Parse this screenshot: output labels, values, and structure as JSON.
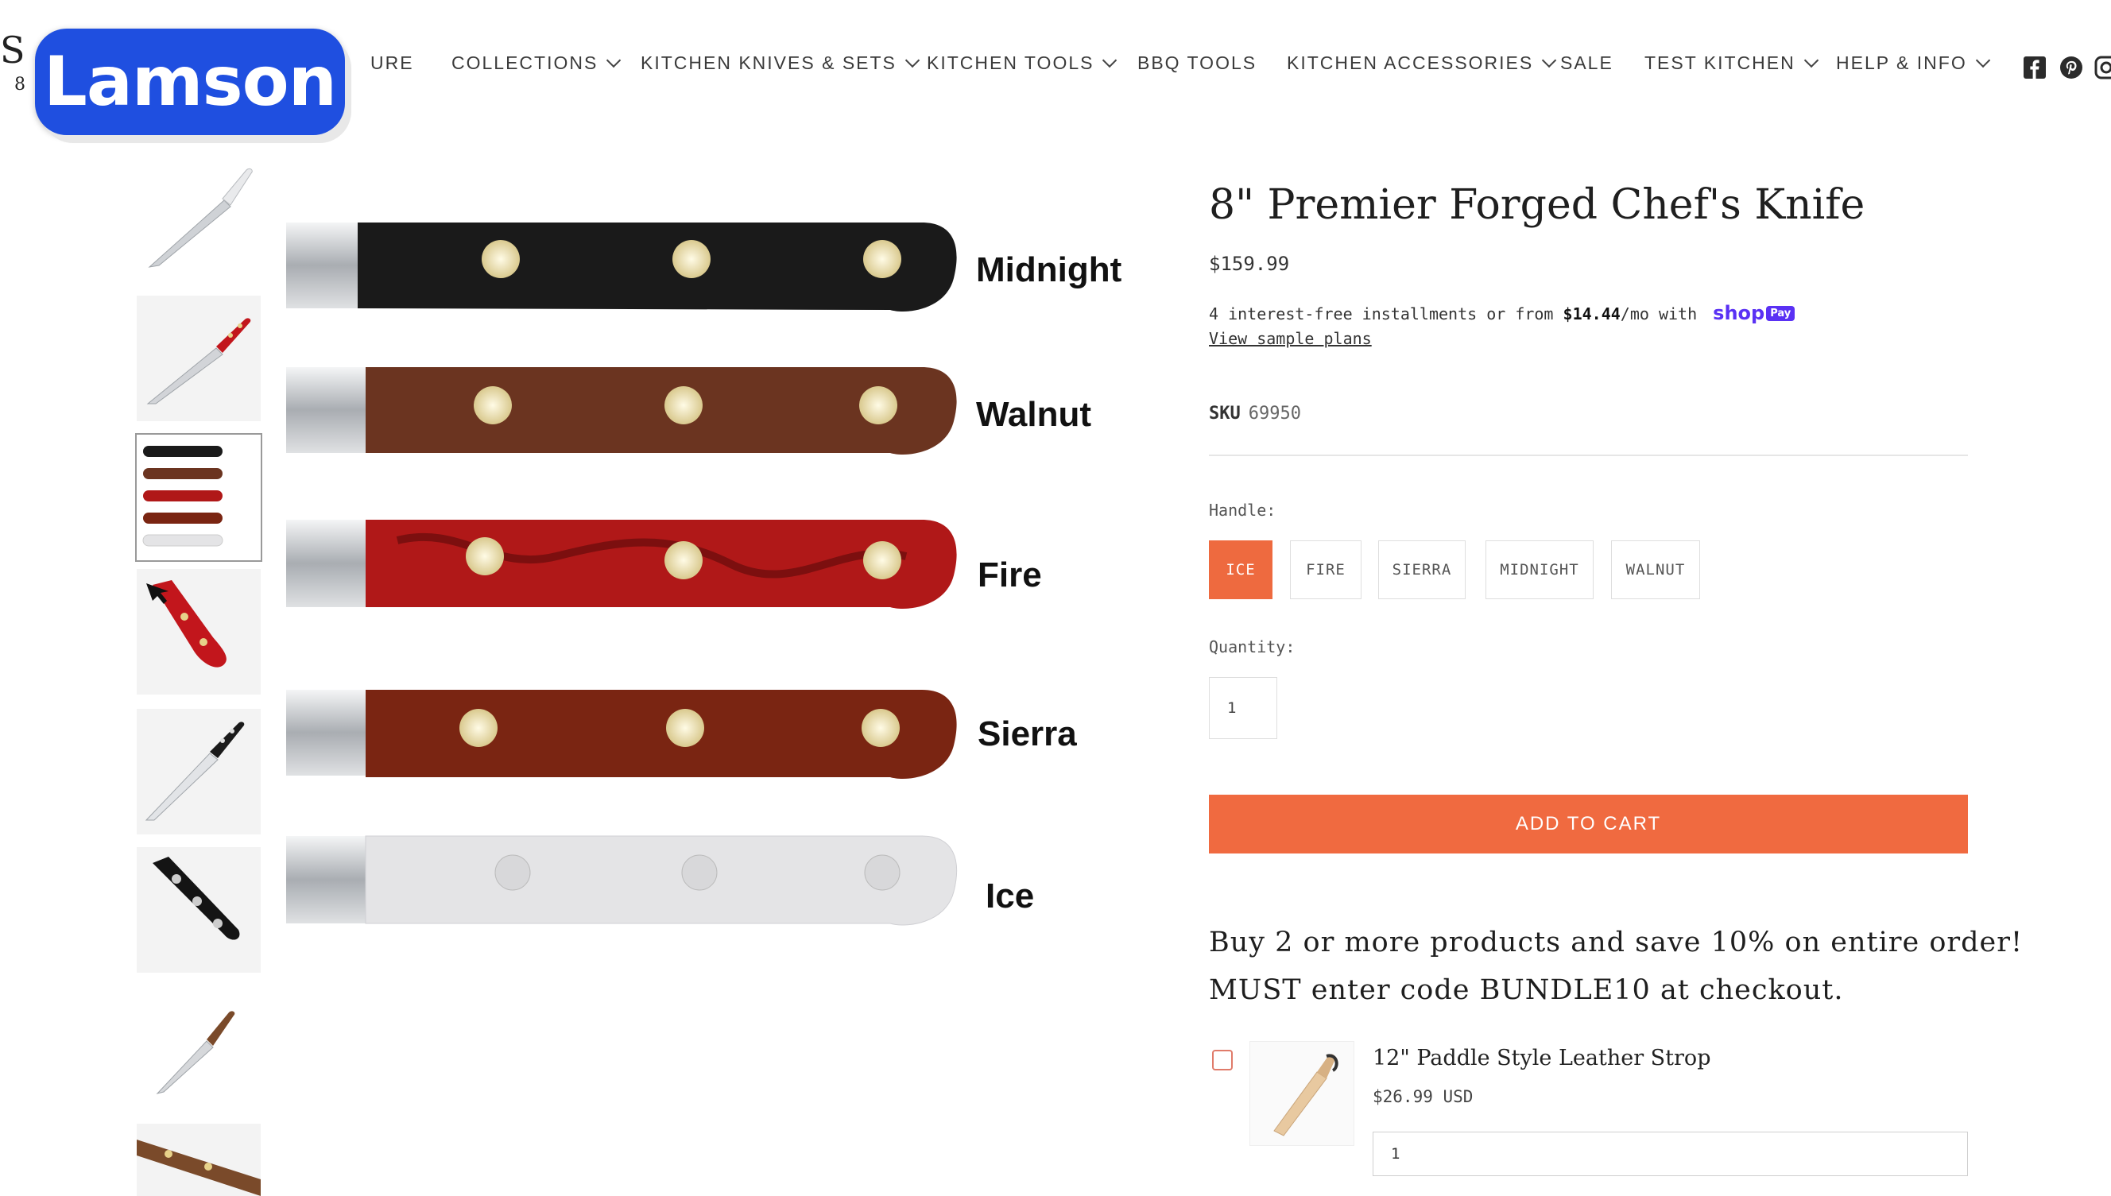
{
  "header": {
    "logo_fragment": "S",
    "logo_sub": "8",
    "badge_text": "Lamson",
    "nav": [
      {
        "label": "URE",
        "has_menu": false
      },
      {
        "label": "COLLECTIONS",
        "has_menu": true
      },
      {
        "label": "KITCHEN KNIVES & SETS",
        "has_menu": true
      },
      {
        "label": "KITCHEN TOOLS",
        "has_menu": true
      },
      {
        "label": "BBQ TOOLS",
        "has_menu": false
      },
      {
        "label": "KITCHEN ACCESSORIES",
        "has_menu": true
      },
      {
        "label": "SALE",
        "has_menu": false
      },
      {
        "label": "TEST KITCHEN",
        "has_menu": true
      },
      {
        "label": "HELP & INFO",
        "has_menu": true
      }
    ],
    "social_icons": [
      "facebook-icon",
      "pinterest-icon",
      "instagram-icon"
    ]
  },
  "gallery": {
    "thumbnails": [
      "chef-knife-silver",
      "chef-knife-red",
      "handle-color-chart",
      "red-handle-closeup",
      "chef-knife-black",
      "black-handle-closeup",
      "paring-knife",
      "walnut-handle-knife"
    ],
    "active_index": 2,
    "handles": [
      {
        "label": "Midnight",
        "color": "#1a1a1a"
      },
      {
        "label": "Walnut",
        "color": "#6b3420"
      },
      {
        "label": "Fire",
        "color": "#b01818"
      },
      {
        "label": "Sierra",
        "color": "#7a2512"
      },
      {
        "label": "Ice",
        "color": "#e4e4e6"
      }
    ]
  },
  "product": {
    "title": "8\" Premier Forged Chef's Knife",
    "price": "$159.99",
    "installments_prefix": "4 interest-free installments or from",
    "installments_amount": "$14.44",
    "installments_suffix": "/mo with",
    "shop_pay_label": "shop",
    "shop_pay_badge": "Pay",
    "view_plans": "View sample plans",
    "sku_label": "SKU",
    "sku_value": "69950",
    "handle_label": "Handle:",
    "handle_options": [
      "ICE",
      "FIRE",
      "SIERRA",
      "MIDNIGHT",
      "WALNUT"
    ],
    "selected_handle": "ICE",
    "quantity_label": "Quantity:",
    "quantity_value": "1",
    "add_to_cart": "ADD TO CART",
    "accent_color": "#f06a40"
  },
  "promo": {
    "line1": "Buy 2 or more products and save 10% on entire order!",
    "line2": "MUST enter code BUNDLE10 at checkout."
  },
  "upsell": {
    "name": "12\" Paddle Style Leather Strop",
    "price": "$26.99 USD",
    "quantity": "1",
    "checked": false
  }
}
